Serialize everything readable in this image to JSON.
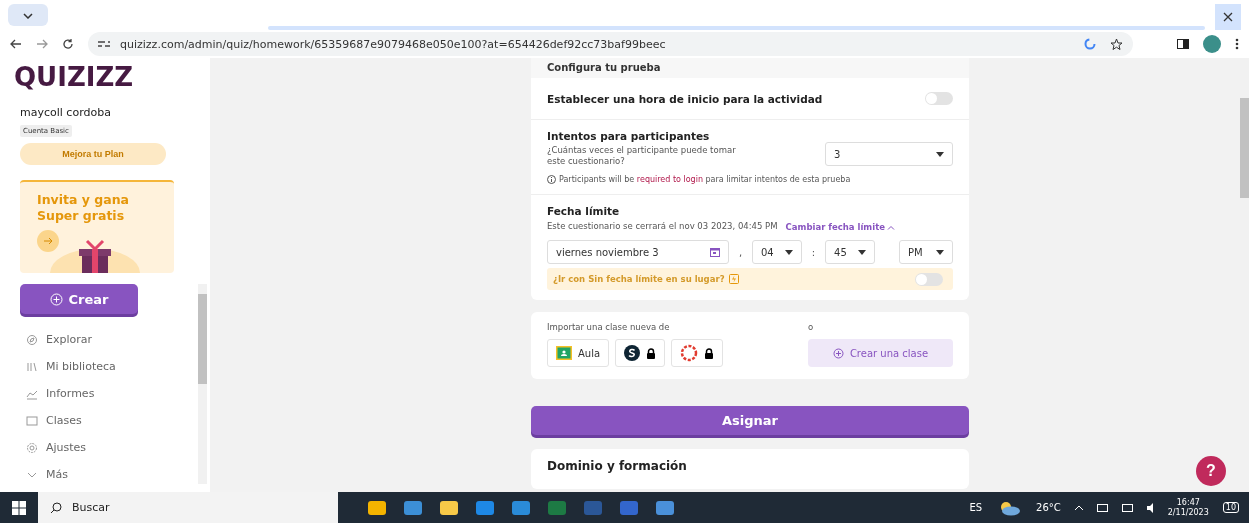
{
  "browser": {
    "url": "quizizz.com/admin/quiz/homework/65359687e9079468e050e100?at=654426def92cc73baf99beec"
  },
  "sidebar": {
    "logo": "QUIZIZZ",
    "user_name": "maycoll cordoba",
    "account_badge": "Cuenta Basic",
    "upgrade_button": "Mejora tu Plan",
    "promo": {
      "title": "Invita y gana Super gratis"
    },
    "create_button": "Crear",
    "items": [
      {
        "label": "Explorar",
        "kind": "explore"
      },
      {
        "label": "Mi biblioteca",
        "kind": "library"
      },
      {
        "label": "Informes",
        "kind": "reports"
      },
      {
        "label": "Clases",
        "kind": "classes"
      },
      {
        "label": "Ajustes",
        "kind": "settings"
      },
      {
        "label": "Más",
        "kind": "more"
      }
    ]
  },
  "settings_card": {
    "title": "Configura tu prueba",
    "start_time": {
      "label": "Establecer una hora de inicio para la actividad",
      "on": false
    },
    "attempts": {
      "title": "Intentos para participantes",
      "description": "¿Cuántas veces el participante puede tomar este cuestionario?",
      "value": "3",
      "note": "Participants will be **required to login** para limitar intentos de esta prueba"
    },
    "deadline": {
      "title": "Fecha límite",
      "summary": "Este cuestionario se cerrará el nov 03 2023, 04:45 PM",
      "change_link": "Cambiar fecha límite",
      "date": "viernes noviembre 3",
      "separator": ",",
      "hour": "04",
      "time_separator": ":",
      "minute": "45",
      "period": "PM",
      "no_deadline": {
        "label": "¿Ir con Sin fecha límite en su lugar?",
        "on": false
      }
    }
  },
  "class_card": {
    "import_label": "Importar una clase nueva de",
    "or_label": "o",
    "providers": [
      {
        "kind": "classroom",
        "label": "Aula"
      },
      {
        "kind": "schoology",
        "locked": true
      },
      {
        "kind": "canvas",
        "locked": true
      }
    ],
    "create_class_button": "Crear una clase"
  },
  "assign_button": "Asignar",
  "mastery_card": {
    "title": "Dominio y formación"
  },
  "help_button": "?",
  "taskbar": {
    "search": "Buscar",
    "language": "ES",
    "temperature": "26°C",
    "time": "16:47",
    "date": "2/11/2023",
    "notifications": "10"
  }
}
